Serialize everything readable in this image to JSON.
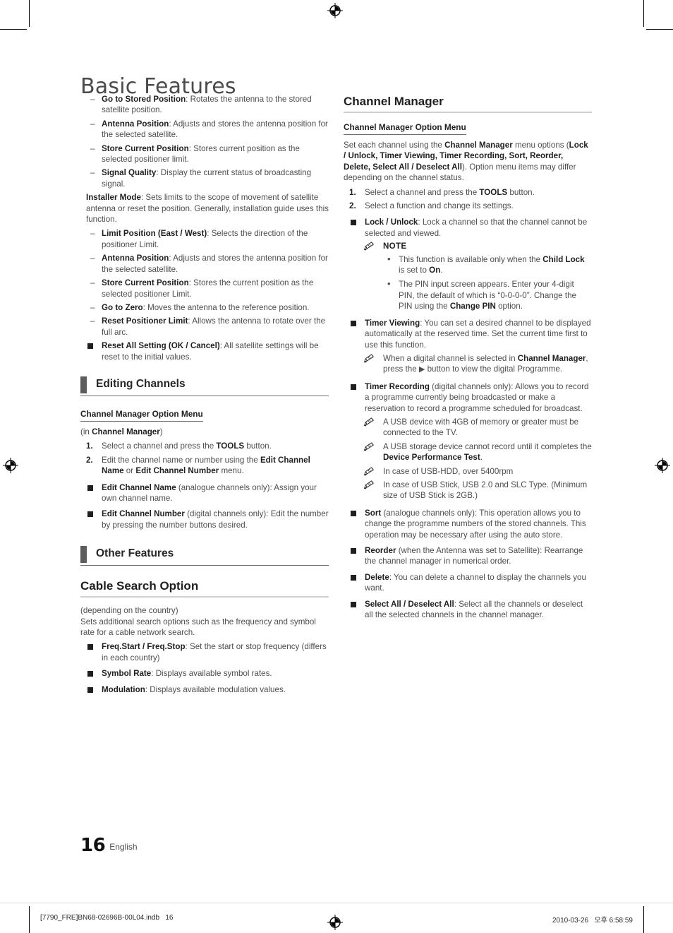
{
  "page": {
    "title": "Basic Features",
    "number": "16",
    "language": "English"
  },
  "footer": {
    "left": "[7790_FRE]BN68-02696B-00L04.indb   16",
    "right": "2010-03-26   오후 6:58:59"
  },
  "left_column": {
    "satellite_items": [
      {
        "marker": "–",
        "label": "Go to Stored Position",
        "sep": ": ",
        "text": "Rotates the antenna to the stored satellite position."
      },
      {
        "marker": "–",
        "label": "Antenna Position",
        "sep": ": ",
        "text": "Adjusts and stores the antenna position for the selected satellite."
      },
      {
        "marker": "–",
        "label": "Store Current Position",
        "sep": ": ",
        "text": "Stores current position as the selected positioner limit."
      },
      {
        "marker": "–",
        "label": "Signal Quality",
        "sep": ": ",
        "text": "Display the current status of broadcasting signal."
      }
    ],
    "installer_mode": {
      "label": "Installer Mode",
      "sep": ": ",
      "text": "Sets limits to the scope of movement of satellite antenna or reset the position. Generally, installation guide uses this function."
    },
    "installer_items": [
      {
        "marker": "–",
        "label": "Limit Position (East / West)",
        "sep": ": ",
        "text": "Selects the direction of the positioner Limit."
      },
      {
        "marker": "–",
        "label": "Antenna Position",
        "sep": ": ",
        "text": "Adjusts and stores the antenna position for the selected satellite."
      },
      {
        "marker": "–",
        "label": "Store Current Position",
        "sep": ": ",
        "text": "Stores the current position as the selected positioner Limit."
      },
      {
        "marker": "–",
        "label": "Go to Zero",
        "sep": ": ",
        "text": "Moves the antenna to the reference position."
      },
      {
        "marker": "–",
        "label": "Reset Positioner Limit",
        "sep": ": ",
        "text": "Allows the antenna to rotate over the full arc."
      }
    ],
    "reset_all": {
      "label": "Reset All Setting (OK / Cancel)",
      "sep": ": ",
      "text": "All satellite settings will be reset to the initial values."
    },
    "editing_channels": {
      "section_title": "Editing Channels",
      "sub_head": "Channel Manager Option Menu",
      "in_line_pre": "(in ",
      "in_line_bold": "Channel Manager",
      "in_line_post": ")",
      "steps": [
        {
          "num": "1.",
          "pre": "Select a channel and press the ",
          "bold": "TOOLS",
          "post": " button."
        },
        {
          "num": "2.",
          "pre": "Edit the channel name or number using the ",
          "bold": "Edit Channel Name",
          "mid": " or ",
          "bold2": "Edit Channel Number",
          "post": " menu."
        }
      ],
      "options": [
        {
          "label": "Edit Channel Name",
          "paren": " (analogue channels only)",
          "sep": ": ",
          "text": "Assign your own channel name."
        },
        {
          "label": "Edit Channel Number",
          "paren": " (digital channels only)",
          "sep": ": ",
          "text": "Edit the number by pressing the number buttons desired."
        }
      ]
    },
    "other_features": {
      "section_title": "Other Features",
      "heading": "Cable Search Option",
      "note_line": "(depending on the country)",
      "intro": "Sets additional search options such as the frequency and symbol rate for a cable network search.",
      "options": [
        {
          "label": "Freq.Start / Freq.Stop",
          "sep": ": ",
          "text": "Set the start or stop frequency (differs in each country)"
        },
        {
          "label": "Symbol Rate",
          "sep": ": ",
          "text": "Displays available symbol rates."
        },
        {
          "label": "Modulation",
          "sep": ": ",
          "text": "Displays available modulation values."
        }
      ]
    }
  },
  "right_column": {
    "heading": "Channel Manager",
    "sub_head": "Channel Manager Option Menu",
    "intro": {
      "p1": "Set each channel using the ",
      "b1": "Channel Manager",
      "p2": " menu options (",
      "b2": "Lock / Unlock, Timer Viewing, Timer Recording, Sort, Reorder, Delete, Select All / Deselect All",
      "p3": "). Option menu items may differ depending on the channel status."
    },
    "steps": [
      {
        "num": "1.",
        "pre": "Select a channel and press the ",
        "bold": "TOOLS",
        "post": " button."
      },
      {
        "num": "2.",
        "pre": "Select a function and change its settings.",
        "bold": "",
        "post": ""
      }
    ],
    "lock_unlock": {
      "label": "Lock / Unlock",
      "sep": ": ",
      "text": "Lock a channel so that the channel cannot be selected and viewed."
    },
    "note_head": "NOTE",
    "note_bullets": [
      {
        "pre": "This function is available only when the ",
        "b1": "Child Lock",
        "mid": " is set to ",
        "b2": "On",
        "post": "."
      },
      {
        "pre": "The PIN input screen appears. Enter your 4-digit PIN, the default of which is “0-0-0-0”. Change the PIN using the ",
        "b1": "Change PIN",
        "mid": "",
        "b2": "",
        "post": " option."
      }
    ],
    "timer_viewing": {
      "label": "Timer Viewing",
      "sep": ": ",
      "text": "You can set a desired channel to be displayed automatically at the reserved time. Set the current time first to use this function."
    },
    "timer_viewing_note": {
      "pre": "When a digital channel is selected in ",
      "bold": "Channel Manager",
      "mid": ", press the ",
      "arrow": "▶",
      "post": " button to view the digital Programme."
    },
    "timer_recording": {
      "label": "Timer Recording",
      "paren": " (digital channels only)",
      "sep": ": ",
      "text": "Allows you to record a programme currently being broadcasted or make a reservation to record a programme scheduled for broadcast."
    },
    "usb_notes": [
      {
        "pre": "A USB device with 4GB of memory or greater must be connected to the TV.",
        "bold": "",
        "post": ""
      },
      {
        "pre": "A USB storage device cannot record until it completes the ",
        "bold": "Device Performance Test",
        "post": "."
      },
      {
        "pre": "In case of USB-HDD, over 5400rpm",
        "bold": "",
        "post": ""
      },
      {
        "pre": "In case of USB Stick, USB 2.0 and SLC Type. (Minimum size of USB Stick is 2GB.)",
        "bold": "",
        "post": ""
      }
    ],
    "options": [
      {
        "label": "Sort",
        "paren": " (analogue channels only)",
        "sep": ": ",
        "text": "This operation allows you to change the programme numbers of the stored channels. This operation may be necessary after using the auto store."
      },
      {
        "label": "Reorder",
        "paren": " (when the Antenna was set to Satellite)",
        "sep": ": ",
        "text": "Rearrange the channel manager in numerical order."
      },
      {
        "label": "Delete",
        "paren": "",
        "sep": ": ",
        "text": "You can delete a channel to display the channels you want."
      },
      {
        "label": "Select All / Deselect All",
        "paren": "",
        "sep": ": ",
        "text": "Select all the channels or deselect all the selected channels in the channel manager."
      }
    ]
  }
}
